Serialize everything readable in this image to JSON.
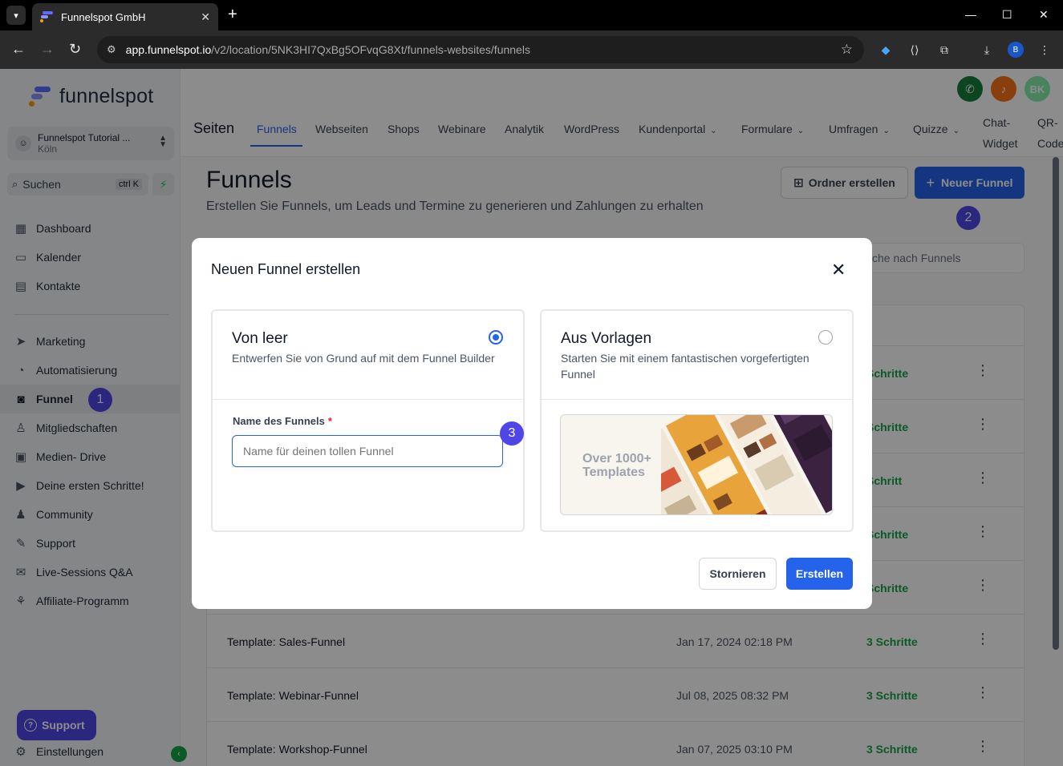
{
  "browser": {
    "tab_title": "Funnelspot GmbH",
    "url_host": "app.funnelspot.io",
    "url_path": "/v2/location/5NK3HI7QxBg5OFvqG8Xt/funnels-websites/funnels",
    "profile_initial": "B"
  },
  "sidebar": {
    "logo_text": "funnelspot",
    "location_name": "Funnelspot Tutorial ...",
    "location_city": "Köln",
    "search_label": "Suchen",
    "search_shortcut": "ctrl K",
    "items": [
      {
        "label": "Dashboard",
        "icon": "dashboard-icon"
      },
      {
        "label": "Kalender",
        "icon": "calendar-icon"
      },
      {
        "label": "Kontakte",
        "icon": "contacts-icon"
      },
      {
        "label": "Marketing",
        "icon": "send-icon"
      },
      {
        "label": "Automatisierung",
        "icon": "automation-icon"
      },
      {
        "label": "Funnel",
        "icon": "funnel-icon"
      },
      {
        "label": "Mitgliedschaften",
        "icon": "membership-icon"
      },
      {
        "label": "Medien- Drive",
        "icon": "media-icon"
      },
      {
        "label": "Deine ersten Schritte!",
        "icon": "play-icon"
      },
      {
        "label": "Community",
        "icon": "community-icon"
      },
      {
        "label": "Support",
        "icon": "wrench-icon"
      },
      {
        "label": "Live-Sessions Q&A",
        "icon": "chat-icon"
      },
      {
        "label": "Affiliate-Programm",
        "icon": "affiliate-icon"
      }
    ],
    "settings_label": "Einstellungen",
    "support_button": "Support"
  },
  "top": {
    "avatar_initials": "BK",
    "section_title": "Seiten",
    "tabs": [
      {
        "label": "Funnels"
      },
      {
        "label": "Webseiten"
      },
      {
        "label": "Shops"
      },
      {
        "label": "Webinare"
      },
      {
        "label": "Analytik"
      },
      {
        "label": "WordPress"
      },
      {
        "label": "Kundenportal"
      },
      {
        "label": "Formulare"
      },
      {
        "label": "Umfragen"
      },
      {
        "label": "Quizze"
      }
    ],
    "tab_chat_widget_1": "Chat-",
    "tab_chat_widget_2": "Widget",
    "tab_qr_1": "QR-",
    "tab_qr_2": "Code"
  },
  "main": {
    "title": "Funnels",
    "subtitle": "Erstellen Sie Funnels, um Leads und Termine zu generieren und Zahlungen zu erhalten",
    "btn_folder": "Ordner erstellen",
    "btn_new": "Neuer Funnel",
    "search_placeholder": "che nach Funnels",
    "rows": [
      {
        "name": "",
        "date": "",
        "steps": "Schritte"
      },
      {
        "name": "",
        "date": "",
        "steps": "Schritte"
      },
      {
        "name": "",
        "date": "",
        "steps": "Schritt"
      },
      {
        "name": "",
        "date": "",
        "steps": "Schritte"
      },
      {
        "name": "",
        "date": "",
        "steps": "Schritte"
      },
      {
        "name": "Template: Sales-Funnel",
        "date": "Jan 17, 2024 02:18 PM",
        "steps": "3 Schritte"
      },
      {
        "name": "Template: Webinar-Funnel",
        "date": "Jul 08, 2025 08:32 PM",
        "steps": "3 Schritte"
      },
      {
        "name": "Template: Workshop-Funnel",
        "date": "Jan 07, 2025 03:10 PM",
        "steps": "3 Schritte"
      }
    ]
  },
  "annotations": [
    "1",
    "2",
    "3"
  ],
  "modal": {
    "title": "Neuen Funnel erstellen",
    "blank": {
      "title": "Von leer",
      "desc": "Entwerfen Sie von Grund auf mit dem Funnel Builder",
      "field_label": "Name des Funnels",
      "required_mark": "*",
      "placeholder": "Name für deinen tollen Funnel"
    },
    "template": {
      "title": "Aus Vorlagen",
      "desc": "Starten Sie mit einem fantastischen vorgefertigten Funnel",
      "image_text_1": "Over 1000+",
      "image_text_2": "Templates"
    },
    "cancel": "Stornieren",
    "create": "Erstellen"
  }
}
